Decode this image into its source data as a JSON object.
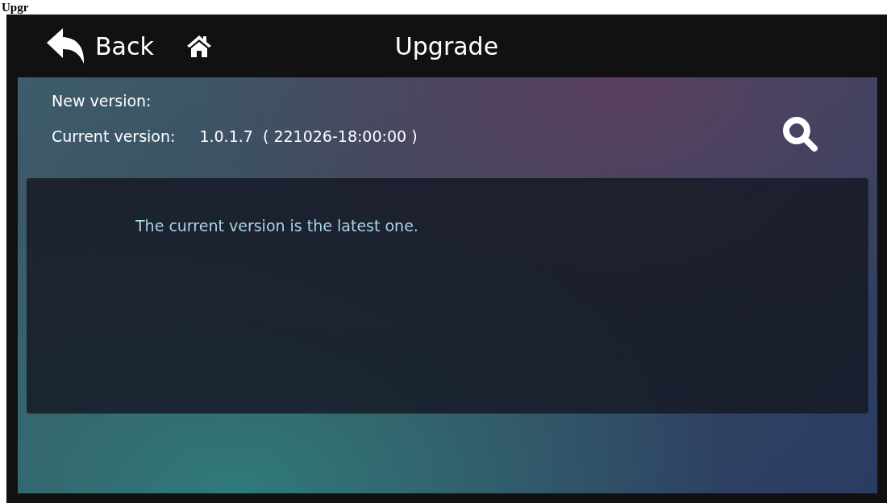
{
  "document_heading": "Upgr",
  "top_bar": {
    "back": {
      "label": "Back"
    },
    "title": "Upgrade"
  },
  "info": {
    "new_version_label": "New version:",
    "current_version_label": "Current version:",
    "current_version_value": "1.0.1.7  ( 221026-18:00:00 )"
  },
  "message": "The current version is the latest one."
}
